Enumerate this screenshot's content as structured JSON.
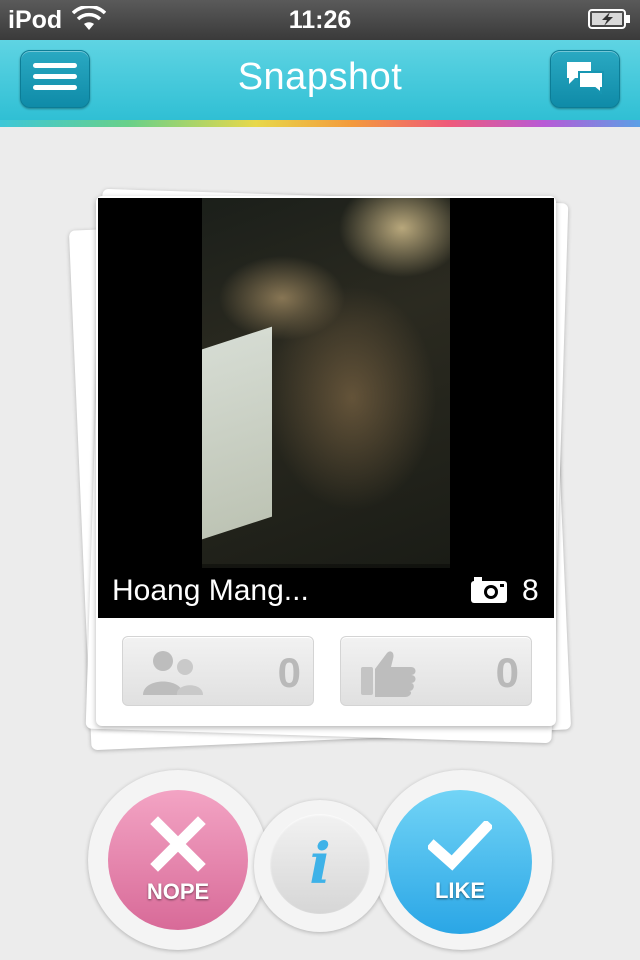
{
  "status_bar": {
    "carrier": "iPod",
    "time": "11:26"
  },
  "nav": {
    "title": "Snapshot",
    "menu_icon": "hamburger-menu-icon",
    "chat_icon": "chat-bubbles-icon"
  },
  "card": {
    "name": "Hoang Mang...",
    "photo_count": "8",
    "friends_count": "0",
    "likes_count": "0"
  },
  "actions": {
    "nope_label": "NOPE",
    "like_label": "LIKE",
    "info_label": "i"
  },
  "colors": {
    "nav_accent": "#2fbfd4",
    "nope": "#d86a98",
    "like": "#2aa6e6",
    "info_glyph": "#3eb2e8"
  }
}
